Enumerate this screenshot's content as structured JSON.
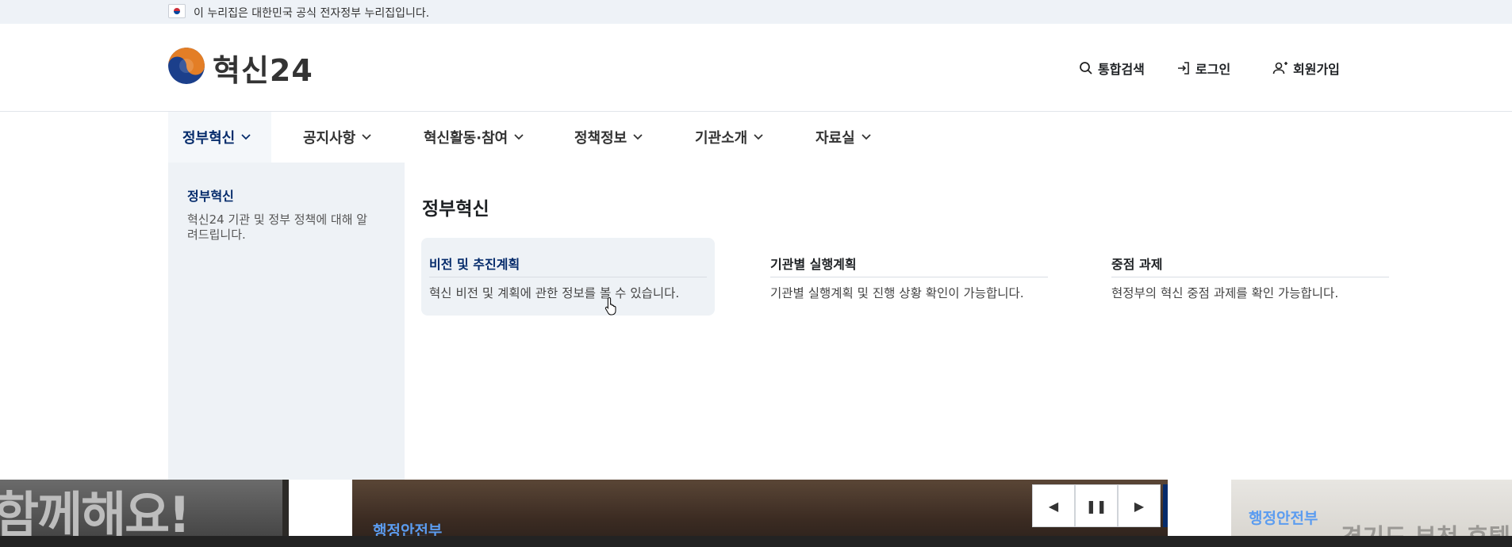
{
  "gov_banner": {
    "text": "이 누리집은 대한민국 공식 전자정부 누리집입니다."
  },
  "header": {
    "logo_text": "혁신24",
    "utilities": [
      {
        "label": "통합검색",
        "icon": "search-icon"
      },
      {
        "label": "로그인",
        "icon": "login-icon"
      },
      {
        "label": "회원가입",
        "icon": "user-add-icon"
      }
    ]
  },
  "nav": {
    "items": [
      {
        "label": "정부혁신"
      },
      {
        "label": "공지사항"
      },
      {
        "label": "혁신활동·참여"
      },
      {
        "label": "정책정보"
      },
      {
        "label": "기관소개"
      },
      {
        "label": "자료실"
      }
    ]
  },
  "mega_menu": {
    "side_title": "정부혁신",
    "side_desc": "혁신24 기관 및 정부 정책에 대해 알려드립니다.",
    "title": "정부혁신",
    "cards": [
      {
        "title": "비전 및 추진계획",
        "desc": "혁신 비전 및 계획에 관한 정보를 볼 수 있습니다."
      },
      {
        "title": "기관별 실행계획",
        "desc": "기관별 실행계획 및 진행 상황 확인이 가능합니다."
      },
      {
        "title": "중점 과제",
        "desc": "현정부의 혁신 중점 과제를 확인 가능합니다."
      }
    ]
  },
  "slider": {
    "slide_left_text": "함께해요!",
    "slide_caption_left": "행정안전부",
    "slide_caption_right": "행정안전부",
    "slide_ghost_text": "경기도 부천 후텔 화재",
    "controls": {
      "prev": "◀",
      "pause": "❚❚",
      "next": "▶",
      "more": "+"
    }
  },
  "colors": {
    "primary": "#052b6b",
    "link": "#5b9cf0",
    "panel_bg": "#eef2f6"
  }
}
